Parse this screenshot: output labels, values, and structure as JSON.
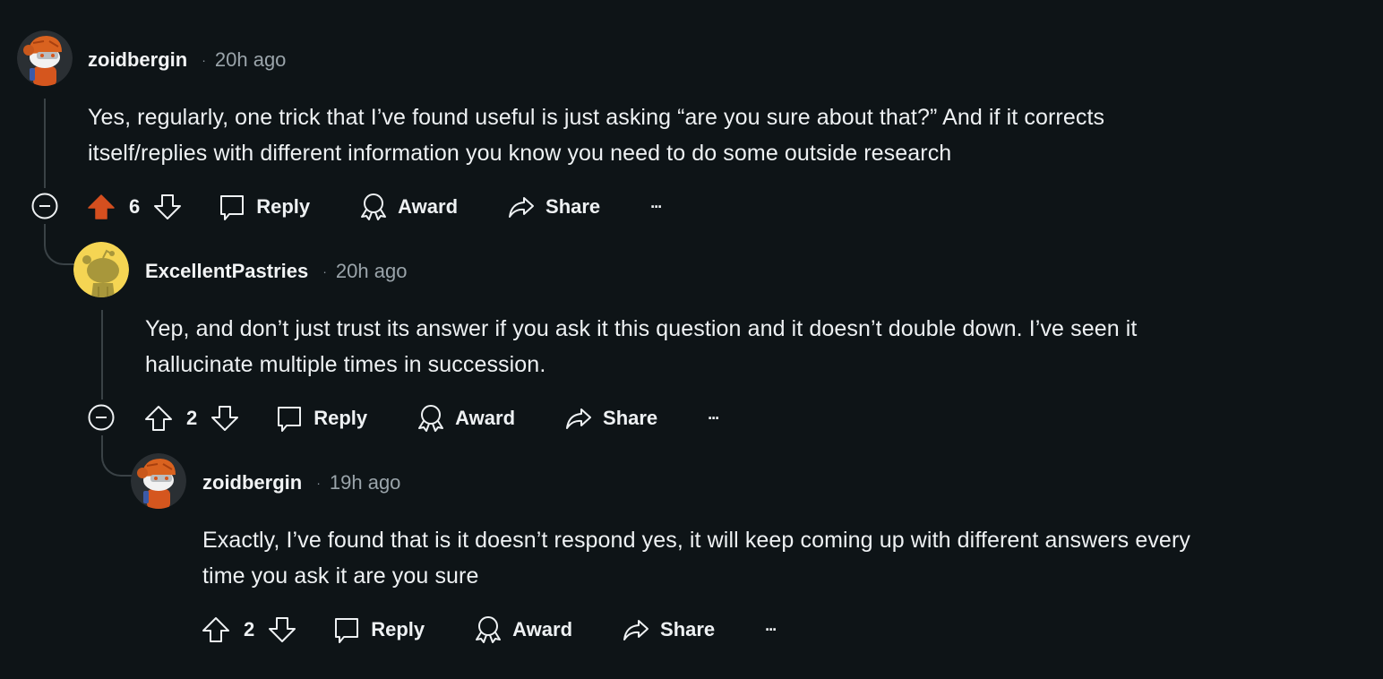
{
  "colors": {
    "background": "#0e1417",
    "upvote_active": "#d44f1f",
    "thread_line": "#3a4246",
    "muted_text": "#9aa4aa"
  },
  "comments": [
    {
      "username": "zoidbergin",
      "separator": "·",
      "time": "20h ago",
      "avatar": "snoo-avatar-orange-helmet",
      "body": "Yes, regularly, one trick that I’ve found useful is just asking “are you sure about that?” And if it corrects\nitself/replies with different information you know you need to do some outside research",
      "votes": "6",
      "upvoted": true,
      "actions": {
        "reply": "Reply",
        "award": "Award",
        "share": "Share",
        "more": "···"
      }
    },
    {
      "username": "ExcellentPastries",
      "separator": "·",
      "time": "20h ago",
      "avatar": "snoo-avatar-default-yellow",
      "body": "Yep, and don’t just trust its answer if you ask it this question and it doesn’t double down. I’ve seen it\nhallucinate multiple times in succession.",
      "votes": "2",
      "upvoted": false,
      "actions": {
        "reply": "Reply",
        "award": "Award",
        "share": "Share",
        "more": "···"
      }
    },
    {
      "username": "zoidbergin",
      "separator": "·",
      "time": "19h ago",
      "avatar": "snoo-avatar-orange-helmet",
      "body": "Exactly, I’ve found that is it doesn’t respond yes, it will keep coming up with different answers every\ntime you ask it are you sure",
      "votes": "2",
      "upvoted": false,
      "actions": {
        "reply": "Reply",
        "award": "Award",
        "share": "Share",
        "more": "···"
      }
    }
  ]
}
